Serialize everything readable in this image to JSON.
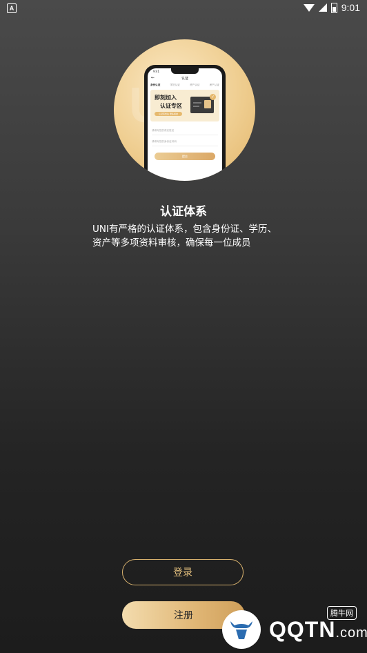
{
  "status_bar": {
    "time": "9:01",
    "notification_icon": "A"
  },
  "hero": {
    "watermark": "UNI",
    "mock_screen": {
      "time": "9:41",
      "nav_title": "认证",
      "back_symbol": "←",
      "tabs": [
        "身份认证",
        "学历认证",
        "资产认证",
        "房产认证"
      ],
      "banner_line1": "即刻加入",
      "banner_line2": "认证专区",
      "banner_pill": "认证有优先 更多权益",
      "check_symbol": "✓",
      "field1_placeholder": "请填写您的真实姓名",
      "field2_placeholder": "请填写您的身份证号码",
      "button": "提交"
    }
  },
  "intro": {
    "title": "认证体系",
    "description": "UNI有严格的认证体系，包含身份证、学历、资产等多项资料审核，确保每一位成员"
  },
  "actions": {
    "login_label": "登录",
    "register_label": "注册"
  },
  "watermark": {
    "site": "QQTN",
    "domain": ".com",
    "tag": "腾牛网"
  },
  "colors": {
    "accent_gold": "#e0b675",
    "login_border": "#d8b26e"
  }
}
